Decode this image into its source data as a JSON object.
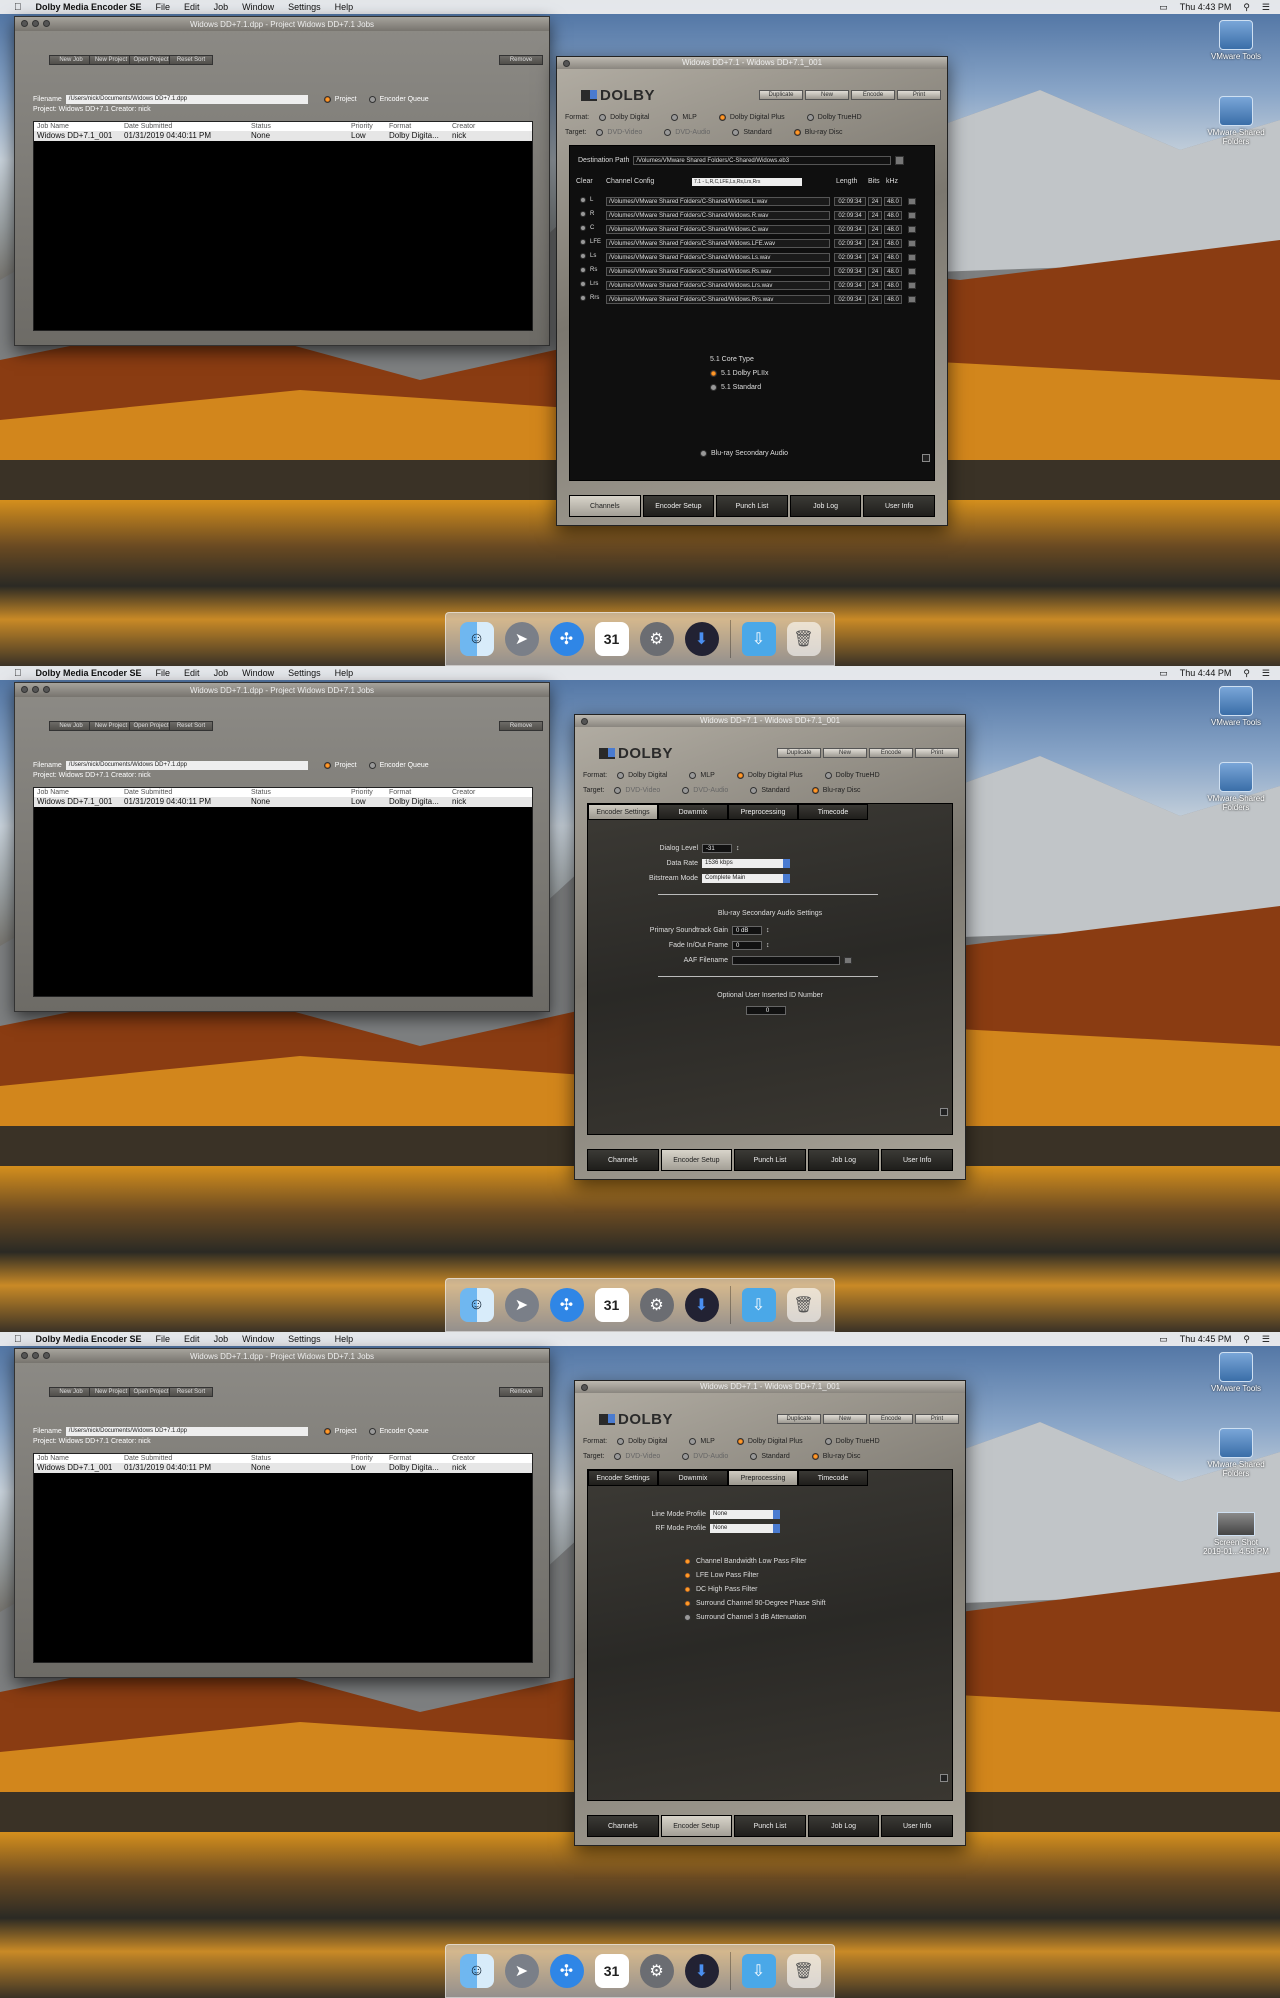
{
  "menubar": {
    "app_name": "Dolby Media Encoder SE",
    "items": [
      "File",
      "Edit",
      "Job",
      "Window",
      "Settings",
      "Help"
    ],
    "times": [
      "Thu 4:43 PM",
      "Thu 4:44 PM",
      "Thu 4:45 PM"
    ]
  },
  "desktop": {
    "icons": [
      "VMware Tools",
      "VMware Shared Folders"
    ],
    "screenshot_icon_line1": "Screen Shot",
    "screenshot_icon_line2": "2019-01...4.58 PM"
  },
  "project_window": {
    "title": "Widows DD+7.1.dpp - Project Widows DD+7.1 Jobs",
    "buttons": [
      "New Job",
      "New Project",
      "Open Project",
      "Reset Sort",
      "Remove"
    ],
    "filename_label": "Filename",
    "filename_value": "/Users/nick/Documents/Widows DD+7.1.dpp",
    "radio_project": "Project",
    "radio_queue": "Encoder Queue",
    "project_line": "Project: Widows DD+7.1     Creator: nick",
    "columns": [
      "Job Name",
      "Date Submitted",
      "Status",
      "Priority",
      "Format",
      "Creator"
    ],
    "row": [
      "Widows DD+7.1_001",
      "01/31/2019 04:40:11 PM",
      "None",
      "Low",
      "Dolby Digita...",
      "nick"
    ]
  },
  "encoder_window": {
    "title": "Widows DD+7.1 - Widows DD+7.1_001",
    "logo": "DOLBY",
    "buttons": [
      "Duplicate",
      "New",
      "Encode",
      "Print"
    ],
    "format_label": "Format:",
    "formats": [
      "Dolby Digital",
      "MLP",
      "Dolby Digital Plus",
      "Dolby TrueHD"
    ],
    "target_label": "Target:",
    "targets": [
      "DVD-Video",
      "DVD-Audio",
      "Standard",
      "Blu-ray Disc"
    ],
    "bottom_tabs": [
      "Channels",
      "Encoder Setup",
      "Punch List",
      "Job Log",
      "User Info"
    ]
  },
  "channels": {
    "destination_label": "Destination Path",
    "destination_value": "/Volumes/VMware Shared Folders/C-Shared/Widows.eb3",
    "clear_label": "Clear",
    "config_label": "Channel Config",
    "config_value": "7.1 - L,R,C,LFE,Ls,Rs,Lrs,Rrs",
    "length_label": "Length",
    "bits_label": "Bits",
    "khz_label": "kHz",
    "rows": [
      {
        "ch": "L",
        "file": "/Volumes/VMware Shared Folders/C-Shared/Widows.L.wav",
        "len": "02:09:34",
        "bits": "24",
        "khz": "48.0"
      },
      {
        "ch": "R",
        "file": "/Volumes/VMware Shared Folders/C-Shared/Widows.R.wav",
        "len": "02:09:34",
        "bits": "24",
        "khz": "48.0"
      },
      {
        "ch": "C",
        "file": "/Volumes/VMware Shared Folders/C-Shared/Widows.C.wav",
        "len": "02:09:34",
        "bits": "24",
        "khz": "48.0"
      },
      {
        "ch": "LFE",
        "file": "/Volumes/VMware Shared Folders/C-Shared/Widows.LFE.wav",
        "len": "02:09:34",
        "bits": "24",
        "khz": "48.0"
      },
      {
        "ch": "Ls",
        "file": "/Volumes/VMware Shared Folders/C-Shared/Widows.Ls.wav",
        "len": "02:09:34",
        "bits": "24",
        "khz": "48.0"
      },
      {
        "ch": "Rs",
        "file": "/Volumes/VMware Shared Folders/C-Shared/Widows.Rs.wav",
        "len": "02:09:34",
        "bits": "24",
        "khz": "48.0"
      },
      {
        "ch": "Lrs",
        "file": "/Volumes/VMware Shared Folders/C-Shared/Widows.Lrs.wav",
        "len": "02:09:34",
        "bits": "24",
        "khz": "48.0"
      },
      {
        "ch": "Rrs",
        "file": "/Volumes/VMware Shared Folders/C-Shared/Widows.Rrs.wav",
        "len": "02:09:34",
        "bits": "24",
        "khz": "48.0"
      }
    ],
    "core_type_label": "5.1 Core Type",
    "core_options": [
      "5.1 Dolby PLIIx",
      "5.1 Standard"
    ],
    "secondary_audio": "Blu-ray Secondary Audio"
  },
  "encoder_setup": {
    "subtabs": [
      "Encoder Settings",
      "Downmix",
      "Preprocessing",
      "Timecode"
    ],
    "dialog_level_label": "Dialog Level",
    "dialog_level_value": "-31",
    "data_rate_label": "Data Rate",
    "data_rate_value": "1536 kbps",
    "bitstream_mode_label": "Bitstream Mode",
    "bitstream_mode_value": "Complete Main",
    "secondary_header": "Blu-ray Secondary Audio Settings",
    "primary_gain_label": "Primary Soundtrack Gain",
    "primary_gain_value": "0 dB",
    "fade_label": "Fade In/Out Frame",
    "fade_value": "0",
    "aaf_label": "AAF Filename",
    "optional_id_label": "Optional User Inserted ID Number",
    "optional_id_value": "0"
  },
  "preprocessing": {
    "line_mode_label": "Line Mode Profile",
    "line_mode_value": "None",
    "rf_mode_label": "RF Mode Profile",
    "rf_mode_value": "None",
    "options": [
      "Channel Bandwidth Low Pass Filter",
      "LFE Low Pass Filter",
      "DC High Pass Filter",
      "Surround Channel 90-Degree Phase Shift",
      "Surround Channel 3 dB Attenuation"
    ]
  },
  "colors": {
    "accent_orange": "#ff9a2a",
    "panel_dark": "#0f0f0f"
  }
}
